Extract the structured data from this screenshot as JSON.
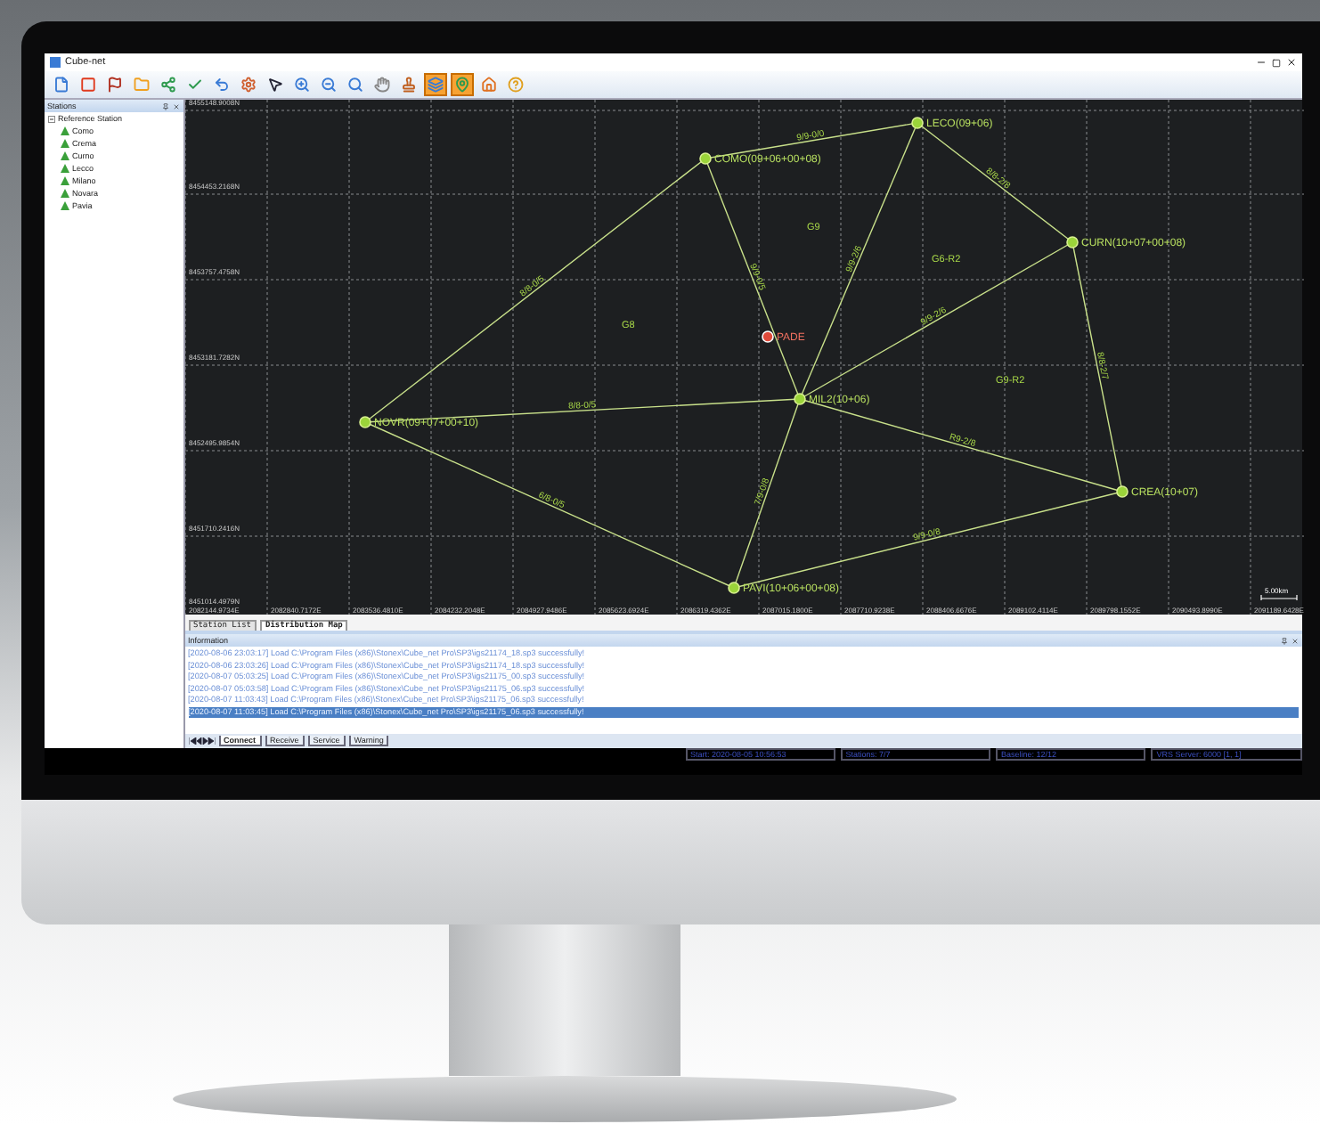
{
  "window": {
    "title": "Cube-net"
  },
  "toolbar": {
    "tools": [
      {
        "selected": false
      },
      {
        "selected": false
      },
      {
        "selected": false
      },
      {
        "selected": false
      },
      {
        "selected": false
      },
      {
        "selected": false
      },
      {
        "selected": false
      },
      {
        "selected": false
      },
      {
        "selected": false
      },
      {
        "selected": false
      },
      {
        "selected": false
      },
      {
        "selected": false
      },
      {
        "selected": false
      },
      {
        "selected": false
      },
      {
        "selected": true
      },
      {
        "selected": true
      },
      {
        "selected": false
      },
      {
        "selected": false
      }
    ]
  },
  "stations_panel": {
    "title": "Stations",
    "tree": [
      {
        "label": "Reference Station",
        "expanded": true,
        "children": [
          {
            "label": "Como"
          },
          {
            "label": "Crema"
          },
          {
            "label": "Curno"
          },
          {
            "label": "Lecco"
          },
          {
            "label": "Milano"
          },
          {
            "label": "Novara"
          },
          {
            "label": "Pavia"
          }
        ]
      }
    ]
  },
  "map": {
    "y_labels": [
      "8455148.9008N",
      "8454453.2168N",
      "8453757.4758N",
      "8453181.7282N",
      "8452495.9854N",
      "8451710.2416N",
      "8451014.4979N"
    ],
    "x_labels": [
      "2082144.9734E",
      "2082840.7172E",
      "2083536.4810E",
      "2084232.2048E",
      "2084927.9486E",
      "2085623.6924E",
      "2086319.4362E",
      "2087015.1800E",
      "2087710.9238E",
      "2088406.6676E",
      "2089102.4114E",
      "2089798.1552E",
      "2090493.8990E",
      "2091189.6428E"
    ],
    "scale": "5.00km",
    "nodes": [
      {
        "label": "COMO(09+06+00+08)",
        "kind": "station"
      },
      {
        "label": "LECO(09+06)",
        "kind": "station"
      },
      {
        "label": "CURN(10+07+00+08)",
        "kind": "station"
      },
      {
        "label": "PADE",
        "kind": "rover"
      },
      {
        "label": "MIL2(10+06)",
        "kind": "station"
      },
      {
        "label": "NOVR(09+07+00+10)",
        "kind": "station"
      },
      {
        "label": "CREA(10+07)",
        "kind": "station"
      },
      {
        "label": "PAVI(10+06+00+08)",
        "kind": "station"
      }
    ],
    "edges": [
      {
        "label": "9/9-0/0"
      },
      {
        "label": "8/8-2/8"
      },
      {
        "label": "8/8-0/5"
      },
      {
        "label": "9/9-0/5"
      },
      {
        "label": "9/9-2/6"
      },
      {
        "label": "9/9-2/6"
      },
      {
        "label": "8/8-2/7"
      },
      {
        "label": "8/8-0/5"
      },
      {
        "label": "R9-2/8"
      },
      {
        "label": "6/8-0/5"
      },
      {
        "label": "7/9-0/8"
      },
      {
        "label": "9/9-0/8"
      }
    ],
    "regions": [
      {
        "label": "G9"
      },
      {
        "label": "G6-R2"
      },
      {
        "label": "G8"
      },
      {
        "label": "G9-R2"
      }
    ]
  },
  "view_tabs": [
    {
      "label": "Station List",
      "selected": false
    },
    {
      "label": "Distribution Map",
      "selected": true
    }
  ],
  "information": {
    "title": "Information",
    "lines": [
      {
        "text": "[2020-08-06 23:03:17] Load C:\\Program Files (x86)\\Stonex\\Cube_net Pro\\SP3\\igs21174_18.sp3 successfully!",
        "selected": false
      },
      {
        "text": "[2020-08-06 23:03:26] Load C:\\Program Files (x86)\\Stonex\\Cube_net Pro\\SP3\\igs21174_18.sp3 successfully!",
        "selected": false
      },
      {
        "text": "[2020-08-07 05:03:25] Load C:\\Program Files (x86)\\Stonex\\Cube_net Pro\\SP3\\igs21175_00.sp3 successfully!",
        "selected": false
      },
      {
        "text": "[2020-08-07 05:03:58] Load C:\\Program Files (x86)\\Stonex\\Cube_net Pro\\SP3\\igs21175_06.sp3 successfully!",
        "selected": false
      },
      {
        "text": "[2020-08-07 11:03:43] Load C:\\Program Files (x86)\\Stonex\\Cube_net Pro\\SP3\\igs21175_06.sp3 successfully!",
        "selected": false
      },
      {
        "text": "[2020-08-07 11:03:45] Load C:\\Program Files (x86)\\Stonex\\Cube_net Pro\\SP3\\igs21175_06.sp3 successfully!",
        "selected": true
      }
    ]
  },
  "info_tabs": [
    {
      "label": "Connect",
      "selected": true
    },
    {
      "label": "Receive",
      "selected": false
    },
    {
      "label": "Service",
      "selected": false
    },
    {
      "label": "Warning",
      "selected": false
    }
  ],
  "status_bar": [
    "Start: 2020-08-05 10:56:53",
    "Stations: 7/7",
    "Baseline: 12/12",
    "VRS Server: 6000 [1, 1]"
  ]
}
